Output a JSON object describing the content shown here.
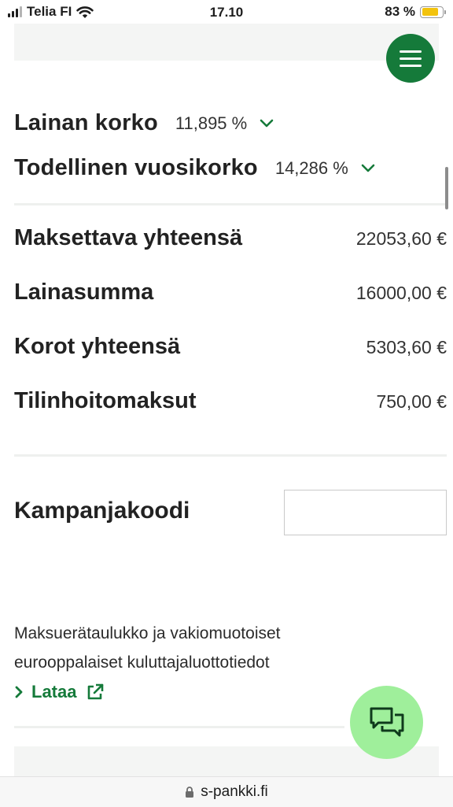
{
  "status_bar": {
    "carrier": "Telia FI",
    "time": "17.10",
    "battery": "83 %",
    "battery_level": 0.83
  },
  "rates": {
    "loan_interest_label": "Lainan korko",
    "loan_interest_value": "11,895 %",
    "effective_rate_label": "Todellinen vuosikorko",
    "effective_rate_value": "14,286 %"
  },
  "summary": {
    "items": [
      {
        "label": "Maksettava yhteensä",
        "value": "22053,60 €"
      },
      {
        "label": "Lainasumma",
        "value": "16000,00 €"
      },
      {
        "label": "Korot yhteensä",
        "value": "5303,60 €"
      },
      {
        "label": "Tilinhoitomaksut",
        "value": "750,00 €"
      }
    ]
  },
  "campaign": {
    "label": "Kampanjakoodi",
    "value": ""
  },
  "info": {
    "text": "Maksuerätaulukko ja vakiomuotoiset eurooppalaiset kuluttajaluottotiedot",
    "link_label": "Lataa"
  },
  "browser": {
    "url": "s-pankki.fi"
  },
  "icons": {
    "menu": "hamburger-menu-icon",
    "chat": "chat-bubbles-icon",
    "external": "external-link-icon",
    "lock": "lock-icon"
  },
  "colors": {
    "brand_green": "#157a3a",
    "chat_green": "#9fef9b",
    "battery_yellow": "#f3c30d"
  }
}
